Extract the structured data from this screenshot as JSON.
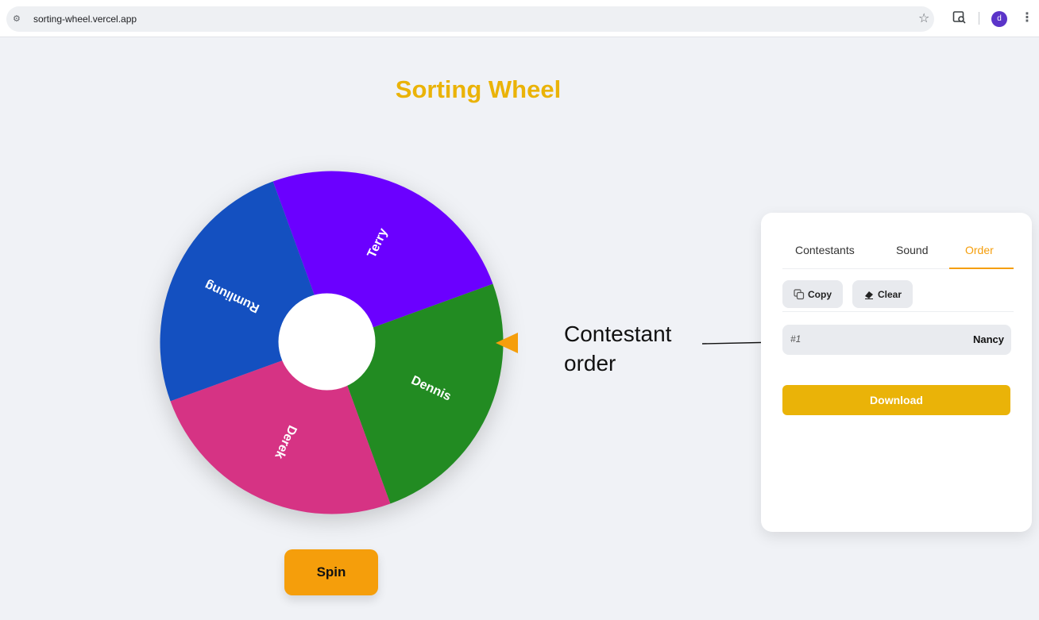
{
  "browser": {
    "url": "sorting-wheel.vercel.app",
    "avatar_initial": "d"
  },
  "app": {
    "title": "Sorting Wheel",
    "spin_label": "Spin",
    "accent_color": "#eab308",
    "pointer_color": "#f59e0b"
  },
  "wheel": {
    "segments": [
      {
        "name": "Terry",
        "color": "#6b00ff"
      },
      {
        "name": "Dennis",
        "color": "#228b22"
      },
      {
        "name": "Derek",
        "color": "#d63384"
      },
      {
        "name": "Rumliung",
        "color": "#1450c0"
      }
    ]
  },
  "annotation": {
    "line1": "Contestant",
    "line2": "order"
  },
  "panel": {
    "tabs": [
      {
        "label": "Contestants",
        "active": false
      },
      {
        "label": "Sound",
        "active": false
      },
      {
        "label": "Order",
        "active": true
      }
    ],
    "copy_label": "Copy",
    "clear_label": "Clear",
    "order": [
      {
        "rank": "#1",
        "name": "Nancy"
      }
    ],
    "download_label": "Download"
  }
}
